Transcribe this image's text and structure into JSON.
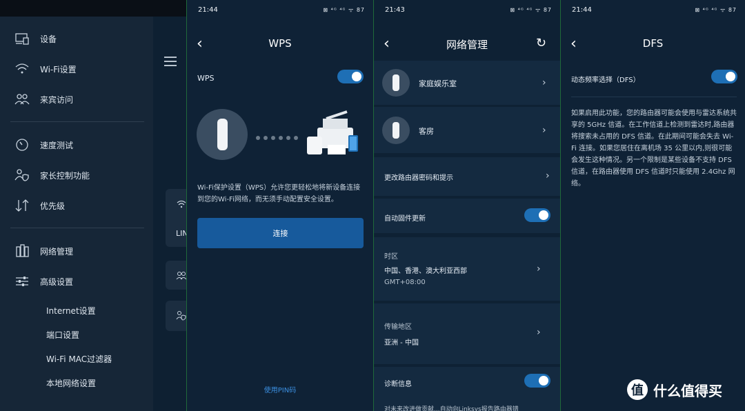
{
  "sidebar": {
    "items": [
      {
        "label": "设备",
        "icon": "devices-icon"
      },
      {
        "label": "Wi-Fi设置",
        "icon": "wifi-icon"
      },
      {
        "label": "来宾访问",
        "icon": "guest-access-icon"
      },
      {
        "label": "速度测试",
        "icon": "speedometer-icon"
      },
      {
        "label": "家长控制功能",
        "icon": "parental-control-icon"
      },
      {
        "label": "优先级",
        "icon": "priority-arrows-icon"
      },
      {
        "label": "网络管理",
        "icon": "network-admin-icon"
      },
      {
        "label": "高级设置",
        "icon": "sliders-icon"
      }
    ],
    "subitems": [
      "Internet设置",
      "端口设置",
      "Wi-Fi MAC过滤器",
      "本地网络设置"
    ],
    "partial_text": "LIN"
  },
  "wps": {
    "time": "21:44",
    "title": "WPS",
    "toggle_label": "WPS",
    "toggle_on": true,
    "description": "Wi-Fi保护设置（WPS）允许您更轻松地将新设备连接到您的Wi-Fi网络，而无须手动配置安全设置。",
    "connect_button": "连接",
    "pin_link": "使用PIN码"
  },
  "network_admin": {
    "time": "21:43",
    "title": "网络管理",
    "nodes": [
      "家庭娱乐室",
      "客房"
    ],
    "change_password": "更改路由器密码和提示",
    "auto_update": "自动固件更新",
    "auto_update_on": true,
    "timezone_label": "时区",
    "timezone_value": "中国、香港、澳大利亚西部",
    "timezone_offset": "GMT+08:00",
    "region_label": "传输地区",
    "region_value": "亚洲 - 中国",
    "diagnostics": "诊断信息",
    "diagnostics_on": true,
    "footer_partial": "对未来改进做贡献...自动向Linksys报告路由器错"
  },
  "dfs": {
    "time": "21:44",
    "title": "DFS",
    "toggle_label": "动态频率选择（DFS）",
    "toggle_on": true,
    "description": "如果启用此功能，您的路由器可能会使用与雷达系统共享的 5GHz 信道。在工作信道上检测到雷达时,路由器将搜索未占用的 DFS 信道。在此期间可能会失去 Wi-Fi 连接。如果您居住在离机场 35 公里以内,则很可能会发生这种情况。另一个限制是某些设备不支持 DFS 信道，在路由器使用 DFS 信道时只能使用 2.4Ghz 网络。"
  },
  "watermark": "什么值得买",
  "status_icons": "⊠ ⁴ᴳ ⁴ᴳ ᯤ 87",
  "colors": {
    "accent": "#1e6fb5",
    "button": "#175a9c",
    "link": "#3b8fe0"
  }
}
